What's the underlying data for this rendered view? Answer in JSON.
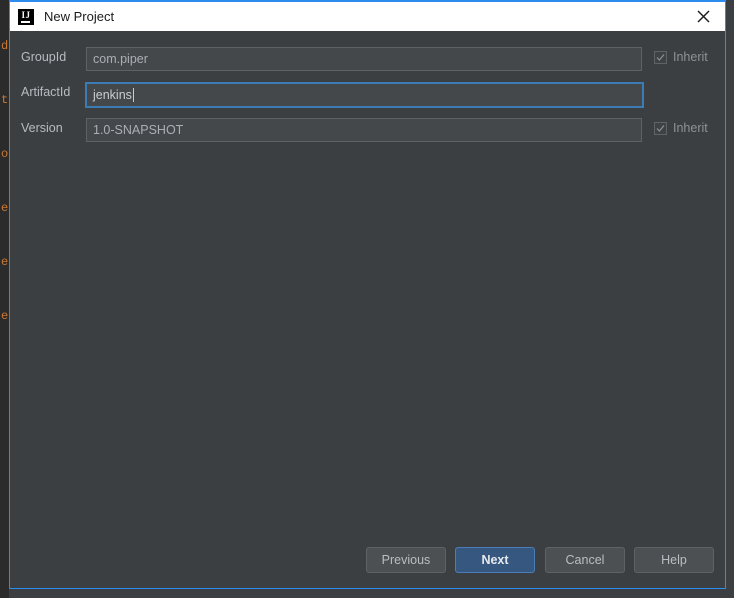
{
  "background": {
    "editor_gutter_chars": [
      "d",
      "t",
      "o",
      "e",
      "e",
      "e"
    ]
  },
  "dialog": {
    "title": "New Project",
    "icon": "intellij-idea-icon",
    "icon_text": "IJ",
    "close_icon": "close-icon",
    "colors": {
      "accent_border": "#2d8cf0",
      "titlebar_bg": "#ffffff",
      "body_bg": "#3c3f41",
      "field_bg": "#45484a",
      "focus_border": "#3c7cb5",
      "default_button_bg": "#365880",
      "gutter_text": "#cc7832"
    },
    "form": {
      "rows": [
        {
          "label": "GroupId",
          "value": "com.piper",
          "placeholder": "",
          "focused": false,
          "inherit": {
            "label": "Inherit",
            "checked": true,
            "enabled": false
          }
        },
        {
          "label": "ArtifactId",
          "value": "jenkins",
          "placeholder": "",
          "focused": true,
          "inherit": null
        },
        {
          "label": "Version",
          "value": "1.0-SNAPSHOT",
          "placeholder": "",
          "focused": false,
          "inherit": {
            "label": "Inherit",
            "checked": true,
            "enabled": false
          }
        }
      ]
    },
    "footer": {
      "previous_label": "Previous",
      "next_label": "Next",
      "cancel_label": "Cancel",
      "help_label": "Help"
    }
  }
}
